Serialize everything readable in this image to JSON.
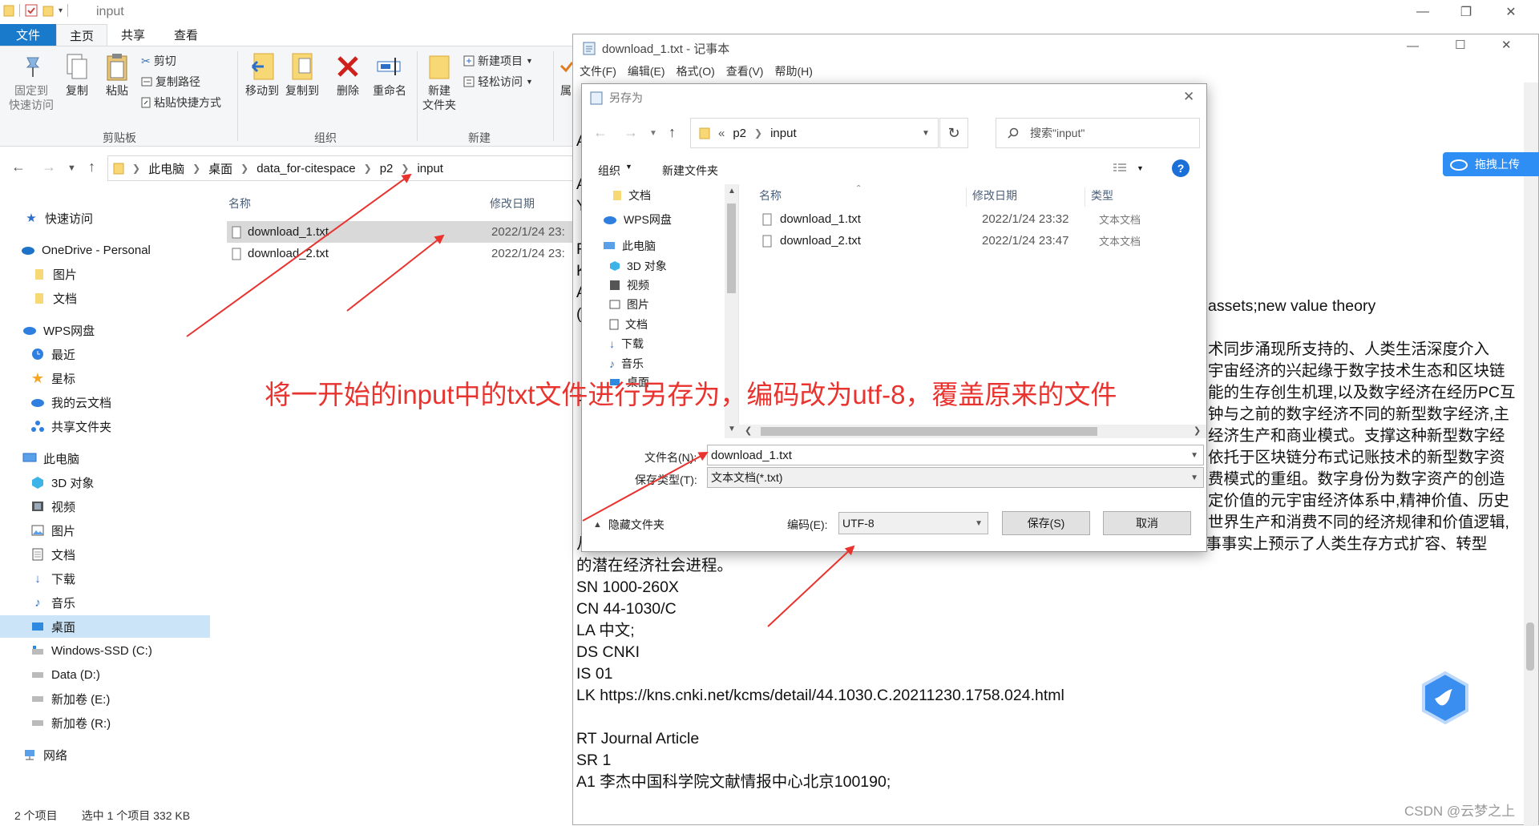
{
  "explorer": {
    "window_title": "input",
    "tabs": {
      "file": "文件",
      "home": "主页",
      "share": "共享",
      "view": "查看"
    },
    "ribbon": {
      "pin": "固定到\n快速访问",
      "copy": "复制",
      "paste": "粘贴",
      "cut": "剪切",
      "copy_path": "复制路径",
      "paste_shortcut": "粘贴快捷方式",
      "clipboard_group": "剪贴板",
      "move_to": "移动到",
      "copy_to": "复制到",
      "delete": "删除",
      "rename": "重命名",
      "organize_group": "组织",
      "new_folder": "新建\n文件夹",
      "new_item": "新建项目",
      "easy_access": "轻松访问",
      "new_group": "新建",
      "props_partial": "属"
    },
    "breadcrumb": [
      "此电脑",
      "桌面",
      "data_for-citespace",
      "p2",
      "input"
    ],
    "nav": {
      "quick_access": "快速访问",
      "onedrive": "OneDrive - Personal",
      "pictures": "图片",
      "documents": "文档",
      "wps": "WPS网盘",
      "recent": "最近",
      "starred": "星标",
      "my_cloud": "我的云文档",
      "shared": "共享文件夹",
      "this_pc": "此电脑",
      "objects3d": "3D 对象",
      "videos": "视频",
      "pictures2": "图片",
      "documents2": "文档",
      "downloads": "下载",
      "music": "音乐",
      "desktop": "桌面",
      "drive_c": "Windows-SSD (C:)",
      "drive_d": "Data (D:)",
      "drive_e": "新加卷 (E:)",
      "drive_r": "新加卷 (R:)",
      "network": "网络"
    },
    "columns": {
      "name": "名称",
      "date": "修改日期"
    },
    "files": [
      {
        "name": "download_1.txt",
        "date": "2022/1/24 23:"
      },
      {
        "name": "download_2.txt",
        "date": "2022/1/24 23:"
      }
    ],
    "status": {
      "count": "2 个项目",
      "selected": "选中 1 个项目  332 KB"
    }
  },
  "notepad": {
    "title": "download_1.txt - 记事本",
    "menu": [
      "文件(F)",
      "编辑(E)",
      "格式(O)",
      "查看(V)",
      "帮助(H)"
    ],
    "right_lines": [
      "assets;new value theory",
      "术同步涌现所支持的、人类生活深度介入",
      "宇宙经济的兴起缘于数字技术生态和区块链",
      "能的生存创生机理,以及数字经济在经历PC互",
      "钟与之前的数字经济不同的新型数字经济,主",
      "经济生产和商业模式。支撑这种新型数字经",
      "依托于区块链分布式记账技术的新型数字资",
      "费模式的重组。数字身份为数字资产的创造",
      "定价值的元宇宙经济体系中,精神价值、历史",
      "世界生产和消费不同的经济规律和价值逻辑,"
    ],
    "lines": [
      "从而将催生出更为丰富多元的数字经济业态,并将极大扩充人类经济的总体量。元宇宙经济叙事事实上预示了人类生存方式扩容、转型",
      "的潜在经济社会进程。",
      "SN 1000-260X",
      "CN 44-1030/C",
      "LA 中文;",
      "DS CNKI",
      "IS 01",
      "LK https://kns.cnki.net/kcms/detail/44.1030.C.20211230.1758.024.html",
      "",
      "RT Journal Article",
      "SR 1",
      "A1 李杰中国科学院文献情报中心北京100190;"
    ],
    "left_edge_chars": [
      "A",
      "《",
      "A",
      "Y",
      "《",
      "F",
      "K",
      "A",
      "(",
      "《",
      "《",
      "《",
      "F",
      "《",
      "《"
    ]
  },
  "saveas": {
    "title": "另存为",
    "path": [
      "p2",
      "input"
    ],
    "search_placeholder": "搜索\"input\"",
    "organize": "组织",
    "new_folder": "新建文件夹",
    "tree": {
      "documents": "文档",
      "wps": "WPS网盘",
      "this_pc": "此电脑",
      "objects3d": "3D 对象",
      "videos": "视频",
      "pictures": "图片",
      "documents2": "文档",
      "downloads": "下载",
      "music": "音乐",
      "desktop": "桌面"
    },
    "columns": {
      "name": "名称",
      "date": "修改日期",
      "type": "类型"
    },
    "files": [
      {
        "name": "download_1.txt",
        "date": "2022/1/24 23:32",
        "type": "文本文档"
      },
      {
        "name": "download_2.txt",
        "date": "2022/1/24 23:47",
        "type": "文本文档"
      }
    ],
    "filename_label": "文件名(N):",
    "filename_value": "download_1.txt",
    "filetype_label": "保存类型(T):",
    "filetype_value": "文本文档(*.txt)",
    "hide_folders": "隐藏文件夹",
    "encoding_label": "编码(E):",
    "encoding_value": "UTF-8",
    "save": "保存(S)",
    "cancel": "取消"
  },
  "annotation": "将一开始的input中的txt文件进行另存为，编码改为utf-8，覆盖原来的文件",
  "cloud_upload": "拖拽上传",
  "watermark": "CSDN @云梦之上",
  "colors": {
    "accent": "#1979ca",
    "annotation": "#e8332f",
    "selection": "#cce4f7"
  }
}
